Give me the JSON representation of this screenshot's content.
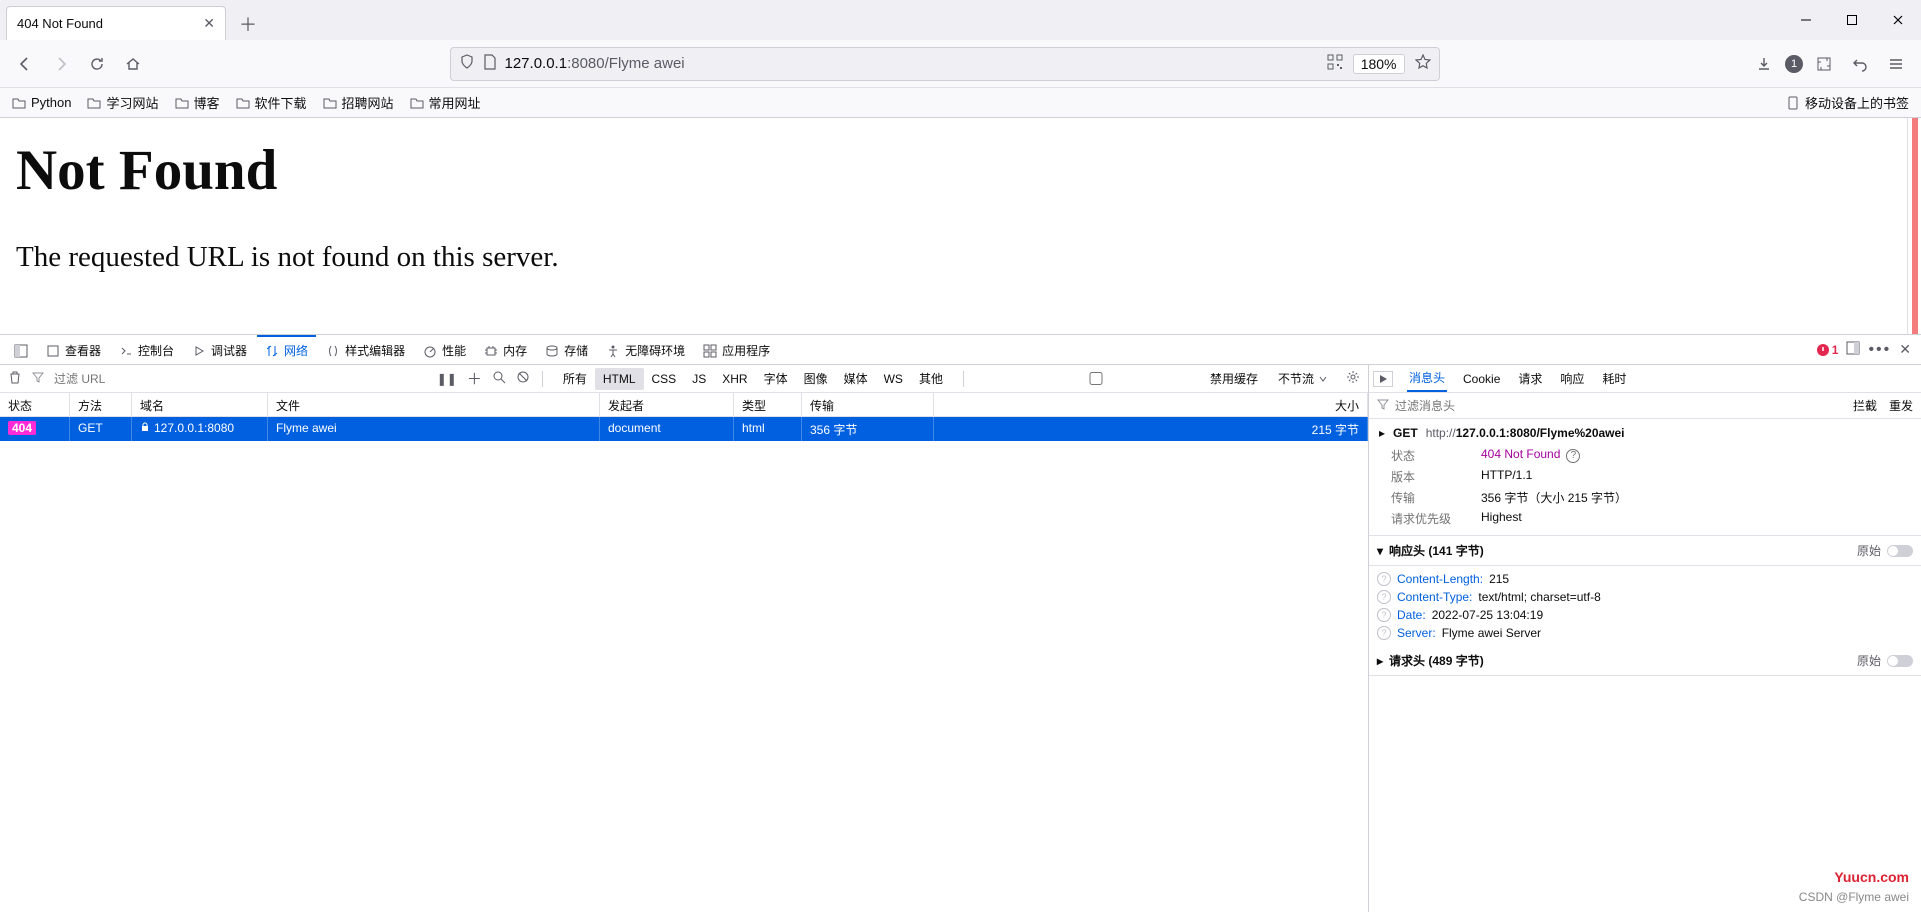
{
  "tab": {
    "title": "404 Not Found"
  },
  "url": {
    "host": "127.0.0.1",
    "port": ":8080",
    "path": "/Flyme awei"
  },
  "zoom": "180%",
  "toolbar_badge": "1",
  "bookmarks": [
    "Python",
    "学习网站",
    "博客",
    "软件下载",
    "招聘网站",
    "常用网址"
  ],
  "mobile_bookmarks": "移动设备上的书签",
  "page": {
    "heading": "Not Found",
    "body": "The requested URL is not found on this server."
  },
  "devtools": {
    "tabs": [
      "查看器",
      "控制台",
      "调试器",
      "网络",
      "样式编辑器",
      "性能",
      "内存",
      "存储",
      "无障碍环境",
      "应用程序"
    ],
    "active_tab": "网络",
    "error_count": "1",
    "filter_placeholder": "过滤 URL",
    "type_filters": [
      "所有",
      "HTML",
      "CSS",
      "JS",
      "XHR",
      "字体",
      "图像",
      "媒体",
      "WS",
      "其他"
    ],
    "type_filter_active": "HTML",
    "disable_cache": "禁用缓存",
    "throttle": "不节流",
    "columns": {
      "status": "状态",
      "method": "方法",
      "domain": "域名",
      "file": "文件",
      "initiator": "发起者",
      "type": "类型",
      "transfer": "传输",
      "size": "大小"
    },
    "row": {
      "status": "404",
      "method": "GET",
      "domain": "127.0.0.1:8080",
      "file": "Flyme awei",
      "initiator": "document",
      "type": "html",
      "transfer": "356 字节",
      "size": "215 字节"
    },
    "detail_tabs": [
      "消息头",
      "Cookie",
      "请求",
      "响应",
      "耗时"
    ],
    "detail_active": "消息头",
    "filter_headers_placeholder": "过滤消息头",
    "intercept": "拦截",
    "resend": "重发",
    "summary": {
      "method": "GET",
      "url_prefix": "http://",
      "url_strong": "127.0.0.1:8080/Flyme%20awei",
      "labels": {
        "status": "状态",
        "version": "版本",
        "transfer": "传输",
        "priority": "请求优先级"
      },
      "status_value": "404 Not Found",
      "version": "HTTP/1.1",
      "transfer": "356 字节（大小 215 字节）",
      "priority": "Highest"
    },
    "response_headers_title": "响应头 (141 字节)",
    "request_headers_title": "请求头 (489 字节)",
    "raw_label": "原始",
    "response_headers": [
      {
        "k": "Content-Length:",
        "v": "215"
      },
      {
        "k": "Content-Type:",
        "v": "text/html; charset=utf-8"
      },
      {
        "k": "Date:",
        "v": "2022-07-25 13:04:19"
      },
      {
        "k": "Server:",
        "v": "Flyme awei Server"
      }
    ]
  },
  "watermark1": "Yuucn.com",
  "watermark2": "CSDN @Flyme awei"
}
